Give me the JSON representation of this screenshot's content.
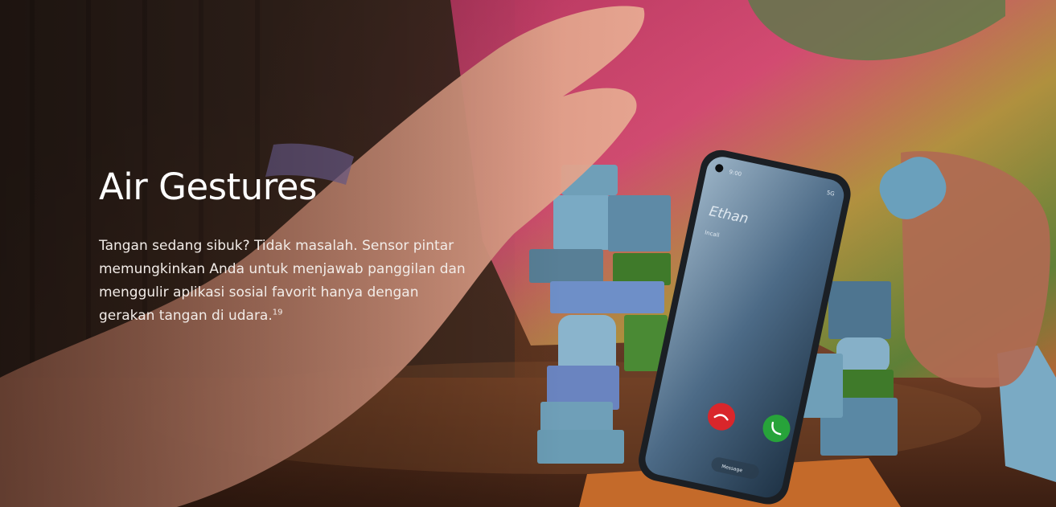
{
  "section": {
    "title": "Air Gestures",
    "description": "Tangan sedang sibuk? Tidak masalah. Sensor pintar memungkinkan Anda untuk menjawab panggilan dan menggulir aplikasi sosial favorit hanya dengan gerakan tangan di udara.",
    "footnote": "19"
  },
  "phone_screen": {
    "time": "9:00",
    "status": "5G",
    "caller_name": "Ethan",
    "call_label": "Incall",
    "message_label": "Message"
  },
  "colors": {
    "decline": "#d9262b",
    "accept": "#27a33a",
    "blocks_blue": "#6f9fb8",
    "blocks_green": "#3f7a2a"
  }
}
